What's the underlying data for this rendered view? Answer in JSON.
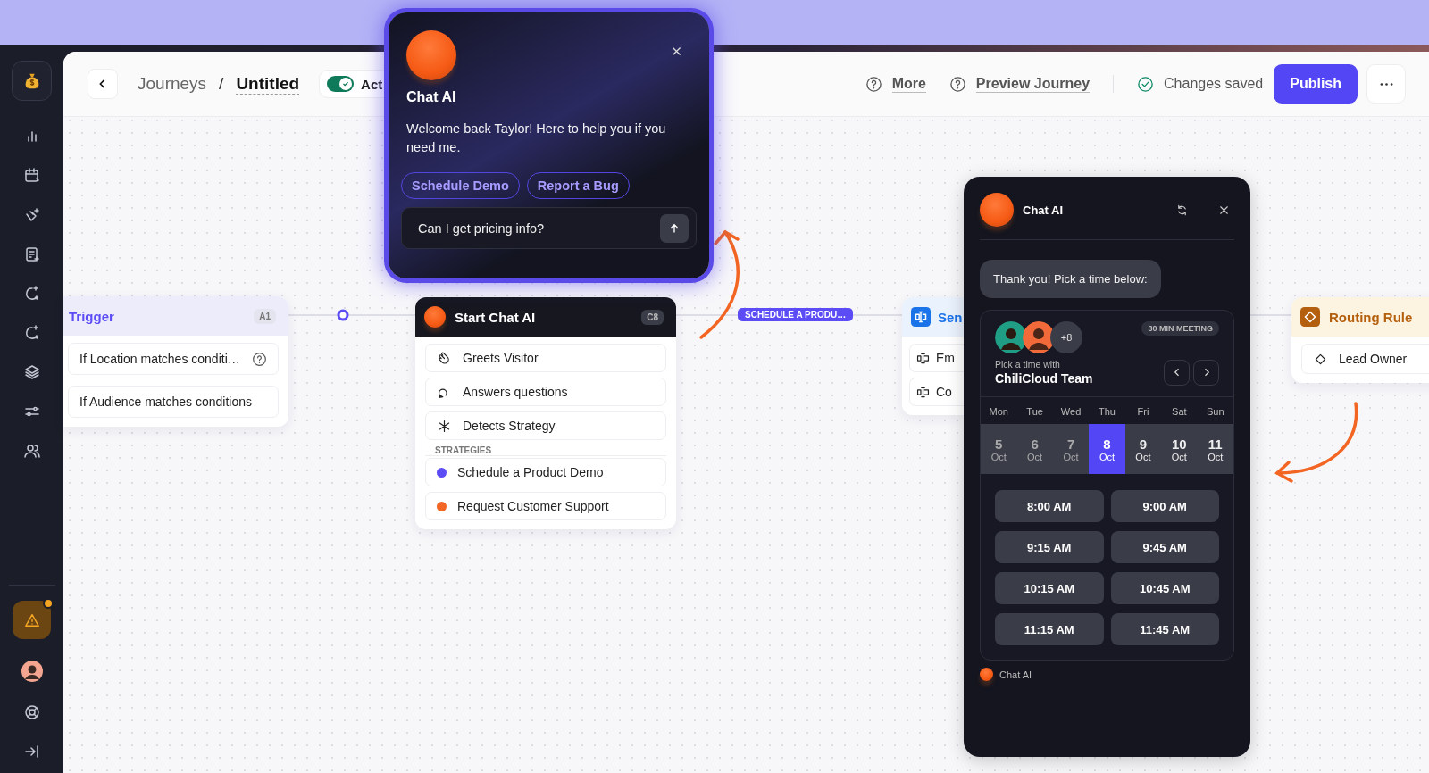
{
  "header": {
    "breadcrumb": [
      "Journeys",
      "Untitled"
    ],
    "separator": "/",
    "toggle": {
      "on": true,
      "label": "Act"
    },
    "links": [
      "More",
      "Preview Journey"
    ],
    "status": "Changes saved",
    "publish": "Publish"
  },
  "chat_popup": {
    "title": "Chat AI",
    "message": "Welcome back Taylor! Here to help you if you need me.",
    "quick_replies": [
      "Schedule Demo",
      "Report a Bug"
    ],
    "input": {
      "value": "Can I get pricing info?"
    }
  },
  "trigger_node": {
    "title": "Trigger",
    "badge": "A1",
    "conditions": [
      {
        "text": "If Location matches conditi…",
        "help": true
      },
      {
        "text": "If Audience matches conditions",
        "help": false
      }
    ]
  },
  "chat_node": {
    "title": "Start Chat AI",
    "badge": "C8",
    "steps": [
      "Greets Visitor",
      "Answers questions",
      "Detects Strategy"
    ],
    "strategies_label": "STRATEGIES",
    "strategies": [
      {
        "label": "Schedule a Product Demo",
        "color": "#5b4cf5"
      },
      {
        "label": "Request Customer Support",
        "color": "#f26522"
      }
    ]
  },
  "edge_label": "SCHEDULE A PRODU…",
  "send_node": {
    "title": "Sen",
    "items": [
      "Em",
      "Co"
    ]
  },
  "routing_node": {
    "title": "Routing Rule",
    "items": [
      "Lead Owner"
    ]
  },
  "chat_panel": {
    "title": "Chat AI",
    "bubble": "Thank you! Pick a time below:",
    "meeting": {
      "badge": "30 MIN MEETING",
      "extra": "+8",
      "subtitle": "Pick a time with",
      "team": "ChiliCloud Team",
      "days": [
        {
          "weekday": "Mon",
          "date": "5",
          "month": "Oct",
          "selected": false
        },
        {
          "weekday": "Tue",
          "date": "6",
          "month": "Oct",
          "selected": false
        },
        {
          "weekday": "Wed",
          "date": "7",
          "month": "Oct",
          "selected": false
        },
        {
          "weekday": "Thu",
          "date": "8",
          "month": "Oct",
          "selected": true
        },
        {
          "weekday": "Fri",
          "date": "9",
          "month": "Oct",
          "selected": false
        },
        {
          "weekday": "Sat",
          "date": "10",
          "month": "Oct",
          "selected": false
        },
        {
          "weekday": "Sun",
          "date": "11",
          "month": "Oct",
          "selected": false
        }
      ],
      "slots": [
        "8:00 AM",
        "9:00 AM",
        "9:15 AM",
        "9:45 AM",
        "10:15 AM",
        "10:45 AM",
        "11:15 AM",
        "11:45 AM"
      ]
    },
    "footer": "Chat AI"
  }
}
